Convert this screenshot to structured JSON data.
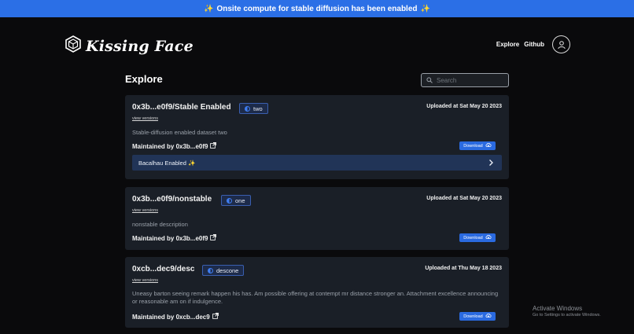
{
  "banner": {
    "text": "Onsite compute for stable diffusion has been enabled",
    "spark": "✨"
  },
  "logo": {
    "text": "Kissing Face",
    "icon": "hexagon-cube-icon"
  },
  "nav": {
    "explore": "Explore",
    "github": "Github",
    "avatar_icon": "user-icon"
  },
  "page": {
    "title": "Explore"
  },
  "search": {
    "placeholder": "Search"
  },
  "cards": [
    {
      "title": "0x3b...e0f9/Stable Enabled",
      "badge": "two",
      "uploaded": "Uploaded at Sat May 20 2023",
      "view_versions": "view versions",
      "description": "Stable-diffusion enabled dataset two",
      "maintained": "Maintained by 0x3b...e0f9",
      "download": "Download",
      "bacalhau": "Bacalhau Enabled ✨"
    },
    {
      "title": "0x3b...e0f9/nonstable",
      "badge": "one",
      "uploaded": "Uploaded at Sat May 20 2023",
      "view_versions": "view versions",
      "description": "nonstable description",
      "maintained": "Maintained by 0x3b...e0f9",
      "download": "Download"
    },
    {
      "title": "0xcb...dec9/desc",
      "badge": "descone",
      "uploaded": "Uploaded at Thu May 18 2023",
      "view_versions": "view versions",
      "description": "Uneasy barton seeing remark happen his has. Am possible offering at contempt mr distance stronger an. Attachment excellence announcing or reasonable am on if indulgence.",
      "maintained": "Maintained by 0xcb...dec9",
      "download": "Download"
    }
  ],
  "windows": {
    "line1": "Activate Windows",
    "line2": "Go to Settings to activate Windows."
  },
  "colors": {
    "banner": "#2b6fe6",
    "background": "#0a0a0c",
    "card": "#1a1f27",
    "button": "#2a6ae0",
    "bacalhau_row": "#213457"
  }
}
